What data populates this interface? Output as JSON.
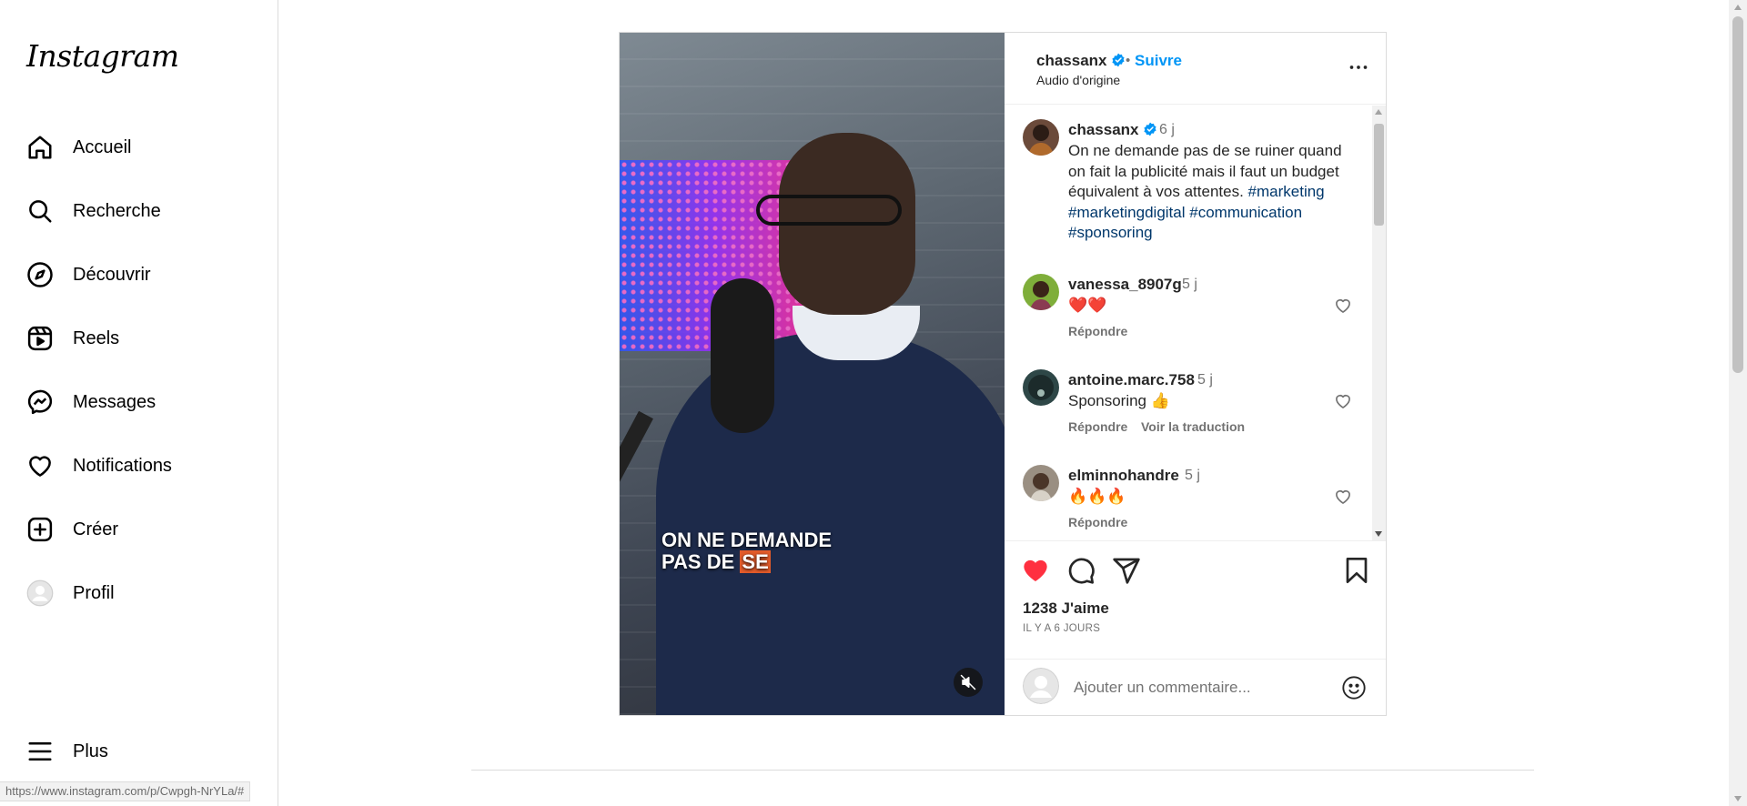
{
  "brand": {
    "logo_text": "Instagram"
  },
  "sidebar": {
    "items": [
      {
        "label": "Accueil",
        "icon": "home-icon"
      },
      {
        "label": "Recherche",
        "icon": "search-icon"
      },
      {
        "label": "Découvrir",
        "icon": "compass-icon"
      },
      {
        "label": "Reels",
        "icon": "reels-icon"
      },
      {
        "label": "Messages",
        "icon": "messenger-icon"
      },
      {
        "label": "Notifications",
        "icon": "heart-icon"
      },
      {
        "label": "Créer",
        "icon": "plus-square-icon"
      },
      {
        "label": "Profil",
        "icon": "avatar-icon"
      }
    ],
    "more_label": "Plus"
  },
  "media": {
    "caption_line1": "ON NE DEMANDE",
    "caption_line2_a": "PAS DE ",
    "caption_line2_b": "SE",
    "muted": true
  },
  "post": {
    "author": "chassanx",
    "verified": true,
    "separator": "•",
    "follow_label": "Suivre",
    "audio": "Audio d'origine",
    "caption": {
      "author": "chassanx",
      "time": "6 j",
      "text": "On ne demande pas de se ruiner quand on fait la publicité mais il faut un budget équivalent à vos attentes.",
      "hashtags": [
        "#marketing",
        "#marketingdigital",
        "#communication",
        "#sponsoring"
      ]
    },
    "comments": [
      {
        "author": "vanessa_8907g",
        "time": "5 j",
        "text": "❤️❤️",
        "reply": "Répondre"
      },
      {
        "author": "antoine.marc.758",
        "time": "5 j",
        "text": "Sponsoring 👍",
        "reply": "Répondre",
        "translate": "Voir la traduction"
      },
      {
        "author": "elminnohandre",
        "time": "5 j",
        "text": "🔥🔥🔥",
        "reply": "Répondre"
      }
    ],
    "likes": "1238 J'aime",
    "liked": true,
    "ago": "IL Y A 6 JOURS",
    "comment_placeholder": "Ajouter un commentaire..."
  },
  "status_url": "https://www.instagram.com/p/Cwpgh-NrYLa/#",
  "colors": {
    "link": "#0095f6",
    "hashtag": "#00376b",
    "liked": "#ff3040"
  }
}
